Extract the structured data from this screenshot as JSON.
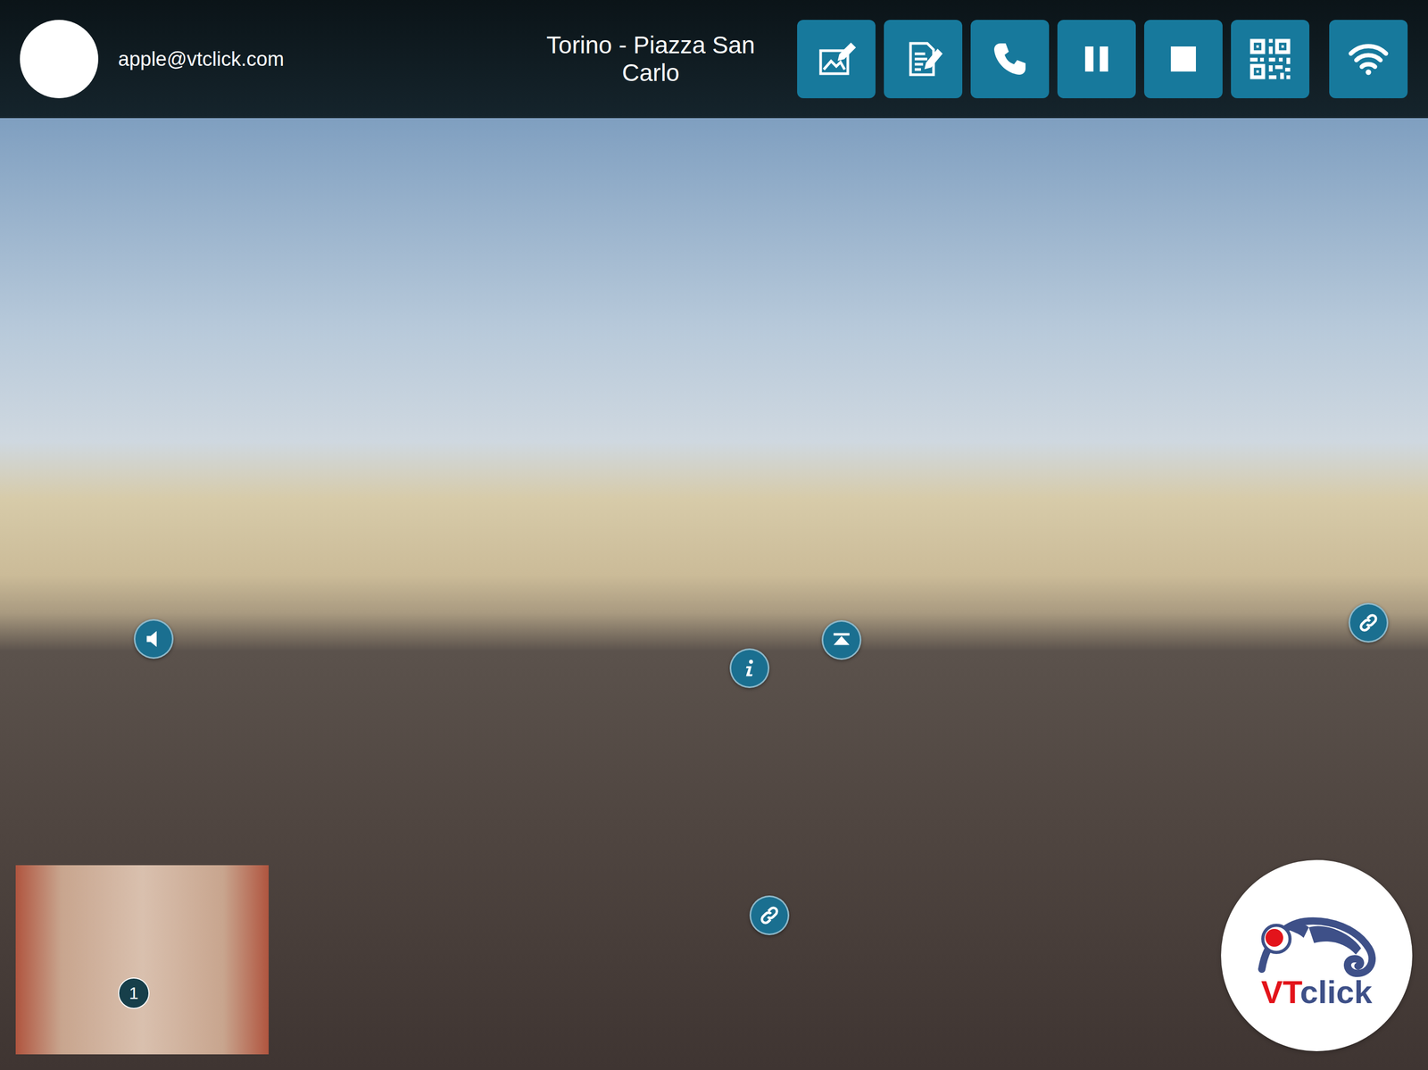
{
  "header": {
    "user": {
      "email": "apple@vtclick.com"
    },
    "title": "Torino - Piazza San Carlo",
    "buttons": [
      {
        "kind": "edit-image"
      },
      {
        "kind": "edit-document"
      },
      {
        "kind": "phone"
      },
      {
        "kind": "pause"
      },
      {
        "kind": "stop"
      },
      {
        "kind": "qr"
      },
      {
        "kind": "wifi"
      }
    ]
  },
  "hotspots": [
    {
      "kind": "audio"
    },
    {
      "kind": "info"
    },
    {
      "kind": "up"
    },
    {
      "kind": "link"
    },
    {
      "kind": "link"
    }
  ],
  "minimap": {
    "marker": "1"
  },
  "logo": {
    "text_red": "VT",
    "text_blue": "click"
  }
}
